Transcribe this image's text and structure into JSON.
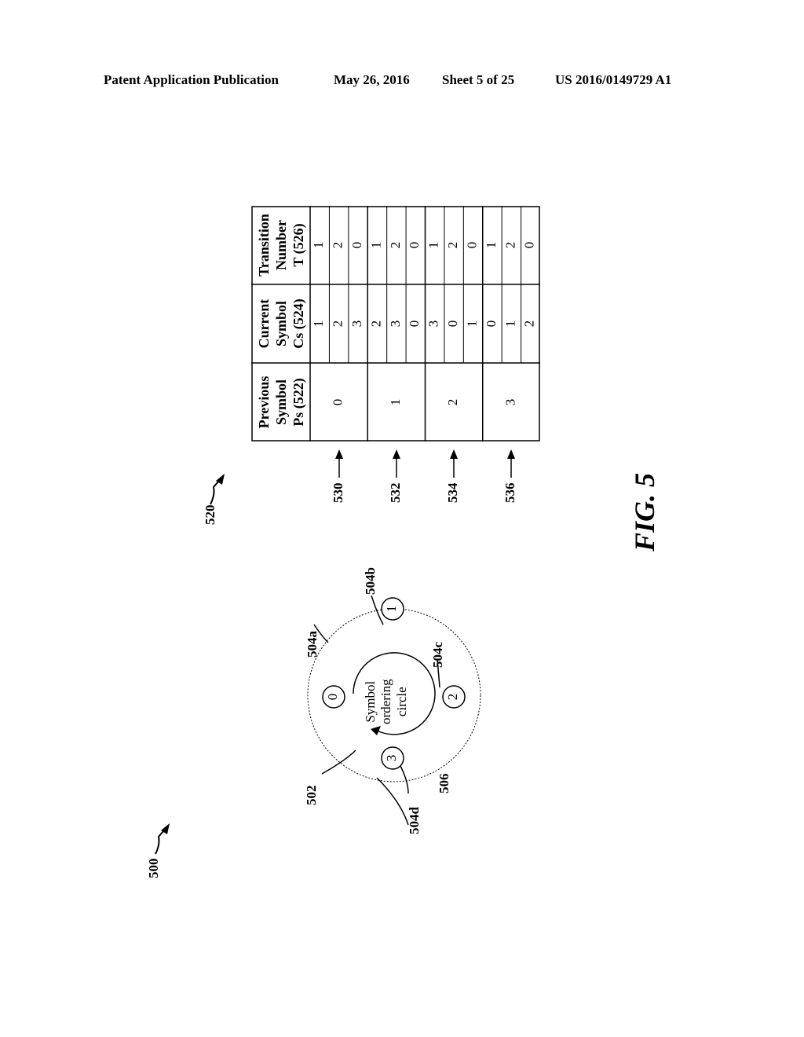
{
  "header": {
    "publication": "Patent Application Publication",
    "date": "May 26, 2016",
    "sheet": "Sheet 5 of 25",
    "number": "US 2016/0149729 A1"
  },
  "figure": {
    "label": "FIG. 5",
    "diagram": {
      "ref": "500",
      "outer_circle_ref": "502",
      "inner_circle_ref": "506",
      "inner_text": [
        "Symbol",
        "ordering",
        "circle"
      ],
      "symbols": [
        {
          "value": "0",
          "ref": "504a"
        },
        {
          "value": "1",
          "ref": "504b"
        },
        {
          "value": "2",
          "ref": "504c"
        },
        {
          "value": "3",
          "ref": "504d"
        }
      ]
    },
    "table": {
      "ref": "520",
      "headers": [
        [
          "Previous",
          "Symbol",
          "Ps (522)"
        ],
        [
          "Current",
          "Symbol",
          "Cs (524)"
        ],
        [
          "Transition",
          "Number",
          "T (526)"
        ]
      ],
      "groups": [
        {
          "ref": "530",
          "previous": "0",
          "rows": [
            [
              "1",
              "1"
            ],
            [
              "2",
              "2"
            ],
            [
              "3",
              "0"
            ]
          ]
        },
        {
          "ref": "532",
          "previous": "1",
          "rows": [
            [
              "2",
              "1"
            ],
            [
              "3",
              "2"
            ],
            [
              "0",
              "0"
            ]
          ]
        },
        {
          "ref": "534",
          "previous": "2",
          "rows": [
            [
              "3",
              "1"
            ],
            [
              "0",
              "2"
            ],
            [
              "1",
              "0"
            ]
          ]
        },
        {
          "ref": "536",
          "previous": "3",
          "rows": [
            [
              "0",
              "1"
            ],
            [
              "1",
              "2"
            ],
            [
              "2",
              "0"
            ]
          ]
        }
      ]
    }
  }
}
